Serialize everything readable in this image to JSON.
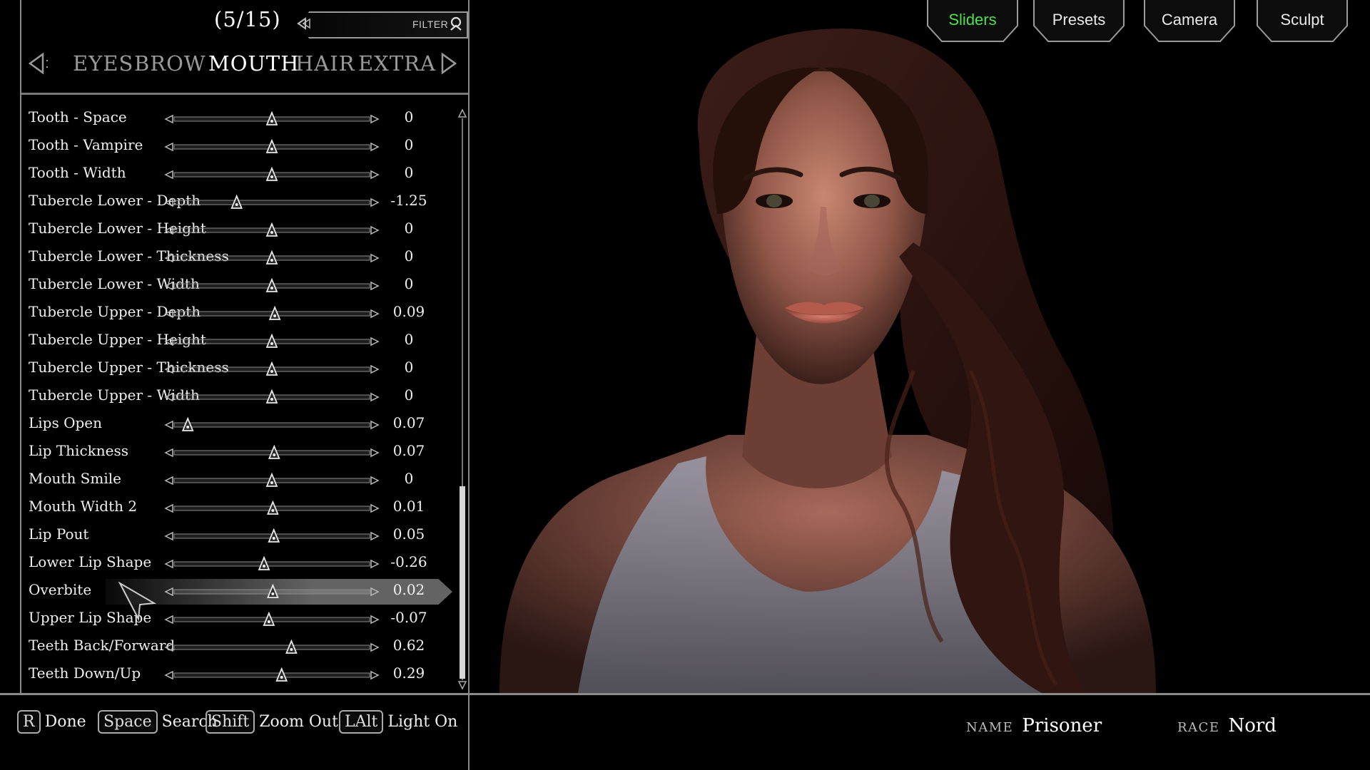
{
  "header": {
    "counter": "(5/15)",
    "filter_label": "FILTER"
  },
  "tabs": [
    {
      "label": "EYES",
      "active": false
    },
    {
      "label": "BROW",
      "active": false
    },
    {
      "label": "MOUTH",
      "active": true
    },
    {
      "label": "HAIR",
      "active": false
    },
    {
      "label": "EXTRA",
      "active": false
    }
  ],
  "sliders": [
    {
      "label": "Tooth - Space",
      "value": "0",
      "level": 0.5,
      "selected": false
    },
    {
      "label": "Tooth - Vampire",
      "value": "0",
      "level": 0.5,
      "selected": false
    },
    {
      "label": "Tooth - Width",
      "value": "0",
      "level": 0.5,
      "selected": false
    },
    {
      "label": "Tubercle Lower - Depth",
      "value": "-1.25",
      "level": 0.32,
      "selected": false
    },
    {
      "label": "Tubercle Lower - Height",
      "value": "0",
      "level": 0.5,
      "selected": false
    },
    {
      "label": "Tubercle Lower - Thickness",
      "value": "0",
      "level": 0.5,
      "selected": false
    },
    {
      "label": "Tubercle Lower - Width",
      "value": "0",
      "level": 0.5,
      "selected": false
    },
    {
      "label": "Tubercle Upper - Depth",
      "value": "0.09",
      "level": 0.515,
      "selected": false
    },
    {
      "label": "Tubercle Upper - Height",
      "value": "0",
      "level": 0.5,
      "selected": false
    },
    {
      "label": "Tubercle Upper - Thickness",
      "value": "0",
      "level": 0.5,
      "selected": false
    },
    {
      "label": "Tubercle Upper - Width",
      "value": "0",
      "level": 0.5,
      "selected": false
    },
    {
      "label": "Lips Open",
      "value": "0.07",
      "level": 0.07,
      "selected": false
    },
    {
      "label": "Lip Thickness",
      "value": "0.07",
      "level": 0.512,
      "selected": false
    },
    {
      "label": "Mouth Smile",
      "value": "0",
      "level": 0.5,
      "selected": false
    },
    {
      "label": "Mouth Width 2",
      "value": "0.01",
      "level": 0.505,
      "selected": false
    },
    {
      "label": "Lip Pout",
      "value": "0.05",
      "level": 0.51,
      "selected": false
    },
    {
      "label": "Lower Lip Shape",
      "value": "-0.26",
      "level": 0.46,
      "selected": false
    },
    {
      "label": "Overbite",
      "value": "0.02",
      "level": 0.505,
      "selected": true
    },
    {
      "label": "Upper Lip Shape",
      "value": "-0.07",
      "level": 0.485,
      "selected": false
    },
    {
      "label": "Teeth Back/Forward",
      "value": "0.62",
      "level": 0.6,
      "selected": false
    },
    {
      "label": "Teeth Down/Up",
      "value": "0.29",
      "level": 0.55,
      "selected": false
    }
  ],
  "top_buttons": [
    {
      "label": "Sliders",
      "active": true
    },
    {
      "label": "Presets",
      "active": false
    },
    {
      "label": "Camera",
      "active": false
    },
    {
      "label": "Sculpt",
      "active": false
    }
  ],
  "hints": [
    {
      "key": "R",
      "label": "Done"
    },
    {
      "key": "Space",
      "label": "Search"
    },
    {
      "key": "Shift",
      "label": "Zoom Out"
    },
    {
      "key": "LAlt",
      "label": "Light On"
    }
  ],
  "character": {
    "name_key": "NAME",
    "name": "Prisoner",
    "race_key": "RACE",
    "race": "Nord"
  },
  "colors": {
    "accent_active": "#4fe04f",
    "text": "#f0f0f0",
    "inactive_tab": "#9a9a9a"
  }
}
